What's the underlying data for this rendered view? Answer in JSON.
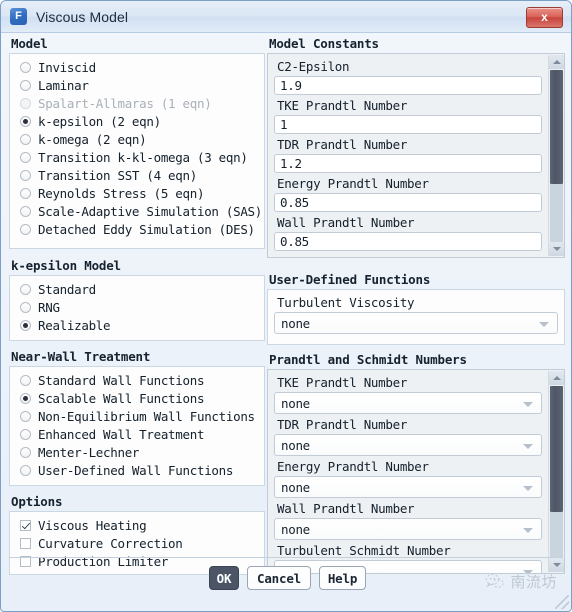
{
  "window": {
    "title": "Viscous Model",
    "app_icon": "fluent-icon",
    "app_icon_letter": "F",
    "close_label": "x",
    "accent_color": "#4b5566",
    "title_bar_color": "#dbe7f5",
    "close_button_color": "#c8443c"
  },
  "model": {
    "group_label": "Model",
    "options": [
      {
        "label": "Inviscid",
        "selected": false,
        "disabled": false
      },
      {
        "label": "Laminar",
        "selected": false,
        "disabled": false
      },
      {
        "label": "Spalart-Allmaras (1 eqn)",
        "selected": false,
        "disabled": true
      },
      {
        "label": "k-epsilon (2 eqn)",
        "selected": true,
        "disabled": false
      },
      {
        "label": "k-omega (2 eqn)",
        "selected": false,
        "disabled": false
      },
      {
        "label": "Transition k-kl-omega (3 eqn)",
        "selected": false,
        "disabled": false
      },
      {
        "label": "Transition SST (4 eqn)",
        "selected": false,
        "disabled": false
      },
      {
        "label": "Reynolds Stress (5 eqn)",
        "selected": false,
        "disabled": false
      },
      {
        "label": "Scale-Adaptive Simulation (SAS)",
        "selected": false,
        "disabled": false
      },
      {
        "label": "Detached Eddy Simulation (DES)",
        "selected": false,
        "disabled": false
      }
    ]
  },
  "k_epsilon_model": {
    "group_label": "k-epsilon Model",
    "options": [
      {
        "label": "Standard",
        "selected": false
      },
      {
        "label": "RNG",
        "selected": false
      },
      {
        "label": "Realizable",
        "selected": true
      }
    ]
  },
  "near_wall_treatment": {
    "group_label": "Near-Wall Treatment",
    "options": [
      {
        "label": "Standard Wall Functions",
        "selected": false
      },
      {
        "label": "Scalable Wall Functions",
        "selected": true
      },
      {
        "label": "Non-Equilibrium Wall Functions",
        "selected": false
      },
      {
        "label": "Enhanced Wall Treatment",
        "selected": false
      },
      {
        "label": "Menter-Lechner",
        "selected": false
      },
      {
        "label": "User-Defined Wall Functions",
        "selected": false
      }
    ]
  },
  "options": {
    "group_label": "Options",
    "items": [
      {
        "label": "Viscous Heating",
        "checked": true
      },
      {
        "label": "Curvature Correction",
        "checked": false
      },
      {
        "label": "Production Limiter",
        "checked": false
      }
    ]
  },
  "model_constants": {
    "group_label": "Model Constants",
    "fields": [
      {
        "label": "C2-Epsilon",
        "value": "1.9"
      },
      {
        "label": "TKE Prandtl Number",
        "value": "1"
      },
      {
        "label": "TDR Prandtl Number",
        "value": "1.2"
      },
      {
        "label": "Energy Prandtl Number",
        "value": "0.85"
      },
      {
        "label": "Wall Prandtl Number",
        "value": "0.85"
      }
    ],
    "scrollbar": {
      "up_icon": "triangle-up-icon",
      "down_icon": "triangle-down-icon"
    }
  },
  "user_defined_functions": {
    "group_label": "User-Defined Functions",
    "fields": [
      {
        "label": "Turbulent Viscosity",
        "value": "none"
      }
    ]
  },
  "prandtl_schmidt": {
    "group_label": "Prandtl and Schmidt Numbers",
    "fields": [
      {
        "label": "TKE Prandtl Number",
        "value": "none"
      },
      {
        "label": "TDR Prandtl Number",
        "value": "none"
      },
      {
        "label": "Energy Prandtl Number",
        "value": "none"
      },
      {
        "label": "Wall Prandtl Number",
        "value": "none"
      },
      {
        "label": "Turbulent Schmidt Number",
        "value": ""
      }
    ],
    "scrollbar": {
      "up_icon": "triangle-up-icon",
      "down_icon": "triangle-down-icon"
    }
  },
  "footer": {
    "ok_label": "OK",
    "cancel_label": "Cancel",
    "help_label": "Help",
    "watermark_text": "南流坊",
    "watermark_icon": "wechat-icon"
  }
}
